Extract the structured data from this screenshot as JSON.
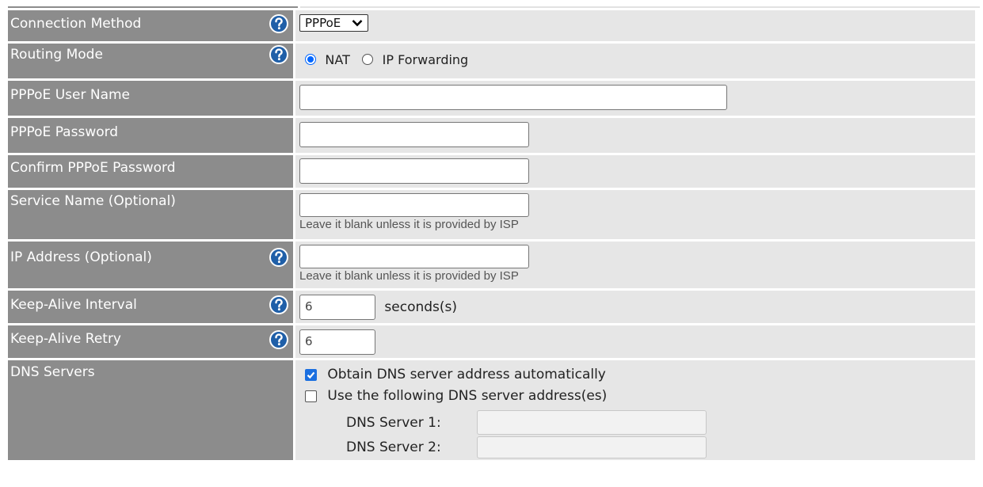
{
  "connection_method": {
    "label": "Connection Method",
    "selected": "PPPoE"
  },
  "routing_mode": {
    "label": "Routing Mode",
    "options": [
      "NAT",
      "IP Forwarding"
    ],
    "selected": "NAT"
  },
  "pppoe_user_name": {
    "label": "PPPoE User Name",
    "value": ""
  },
  "pppoe_password": {
    "label": "PPPoE Password",
    "value": ""
  },
  "confirm_pppoe_password": {
    "label": "Confirm PPPoE Password",
    "value": ""
  },
  "service_name": {
    "label": "Service Name (Optional)",
    "value": "",
    "note": "Leave it blank unless it is provided by ISP"
  },
  "ip_address": {
    "label": "IP Address (Optional)",
    "value": "",
    "note": "Leave it blank unless it is provided by ISP"
  },
  "keep_alive_interval": {
    "label": "Keep-Alive Interval",
    "value": "6",
    "unit": "seconds(s)"
  },
  "keep_alive_retry": {
    "label": "Keep-Alive Retry",
    "value": "6"
  },
  "dns_servers": {
    "label": "DNS Servers",
    "obtain_auto": {
      "label": "Obtain DNS server address automatically",
      "checked": true
    },
    "use_following": {
      "label": "Use the following DNS server address(es)",
      "checked": false
    },
    "server1_label": "DNS Server 1:",
    "server1_value": "",
    "server2_label": "DNS Server 2:",
    "server2_value": ""
  },
  "icons": {
    "help": "help-icon",
    "dropdown": "chevron-down-icon",
    "checkbox_check": "checkmark-icon"
  },
  "colors": {
    "label_bg": "#8c8c8c",
    "value_bg": "#e6e6e6",
    "help_icon": "#1f5fa8",
    "accent": "#1a6fe0"
  }
}
